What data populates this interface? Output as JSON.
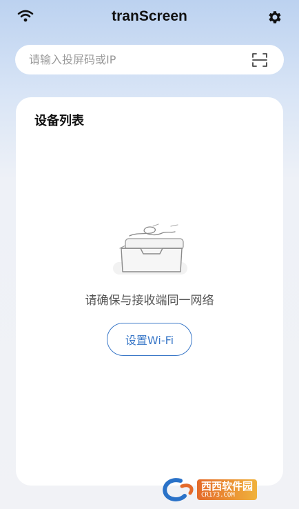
{
  "header": {
    "title": "tranScreen",
    "wifi_icon": "wifi-icon",
    "settings_icon": "gear-icon"
  },
  "search": {
    "placeholder": "请输入投屏码或IP",
    "value": "",
    "scan_icon": "scan-icon"
  },
  "device_list": {
    "title": "设备列表",
    "empty_message": "请确保与接收端同一网络",
    "wifi_button_label": "设置Wi-Fi",
    "empty_icon": "empty-box-icon"
  },
  "watermark": {
    "main_text": "西西软件园",
    "sub_text": "CR173.COM"
  },
  "colors": {
    "accent": "#3a78c8",
    "background_top": "#bcd2f0",
    "card": "#ffffff"
  }
}
